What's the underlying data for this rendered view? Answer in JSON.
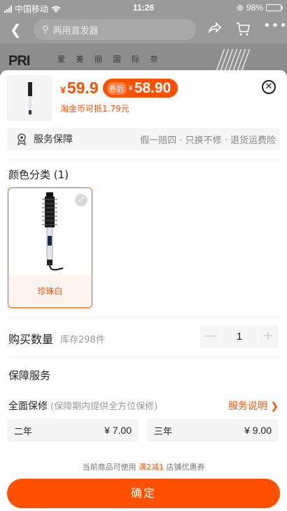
{
  "status_bar": {
    "carrier": "中国移动",
    "time": "11:26",
    "battery": "98%",
    "battery_level": 0.98
  },
  "nav": {
    "search_placeholder": "两用直发器"
  },
  "background": {
    "brand_logo": "PRI",
    "brand_cn": "爱 美 丽 国 际 奈"
  },
  "product": {
    "price_symbol": "¥",
    "price": "59.9",
    "coupon_tag": "券后",
    "coupon_symbol": "¥",
    "coupon_price": "58.90",
    "taojinbi": "淘金币可抵1.79元"
  },
  "service_bar": {
    "label": "服务保障",
    "desc": "假一赔四 · 只换不修 · 退货运费险"
  },
  "color": {
    "title": "颜色分类 (1)",
    "options": [
      {
        "name": "珍珠白",
        "selected": true
      }
    ]
  },
  "quantity": {
    "title": "购买数量",
    "stock": "库存298件",
    "value": "1",
    "minus": "—",
    "plus": "+"
  },
  "guarantee": {
    "title": "保障服务",
    "full_repair": "全面保修",
    "full_repair_note": "(保障期内提供全方位保修)",
    "link": "服务说明 ❯",
    "options": [
      {
        "label": "二年",
        "price": "¥ 7.00"
      },
      {
        "label": "三年",
        "price": "¥ 9.00"
      }
    ]
  },
  "promo": {
    "prefix": "当前商品可使用",
    "highlight": "满2减1",
    "suffix": "店铺优惠券"
  },
  "confirm_label": "确定",
  "colors": {
    "accent": "#ff5000"
  }
}
